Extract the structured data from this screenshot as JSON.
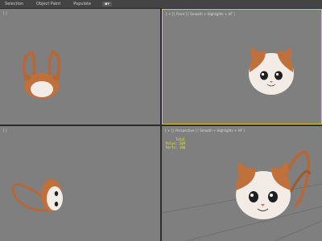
{
  "menubar": {
    "items": [
      "Selection",
      "Object Paint",
      "Populate"
    ],
    "selector_label": "▪▾"
  },
  "viewports": {
    "top_left": {
      "label": "[ ]"
    },
    "top_right": {
      "label": "[ + ] [ Front ] [ Smooth + Highlights + HF ]"
    },
    "bottom_left": {
      "label": "[ ]"
    },
    "bottom_right": {
      "label": "[ + ] [ Perspective ] [ Smooth + Highlights + HF ]"
    }
  },
  "stats": {
    "header": "Total",
    "polys_label": "Polys: 209",
    "verts_label": "Verts: 108"
  },
  "colors": {
    "viewport_bg": "#7f7f7f",
    "active_border": "#d6d600",
    "fur_orange": "#c0703a",
    "fur_white": "#f3ece6",
    "strap_brown": "#b5683a"
  }
}
